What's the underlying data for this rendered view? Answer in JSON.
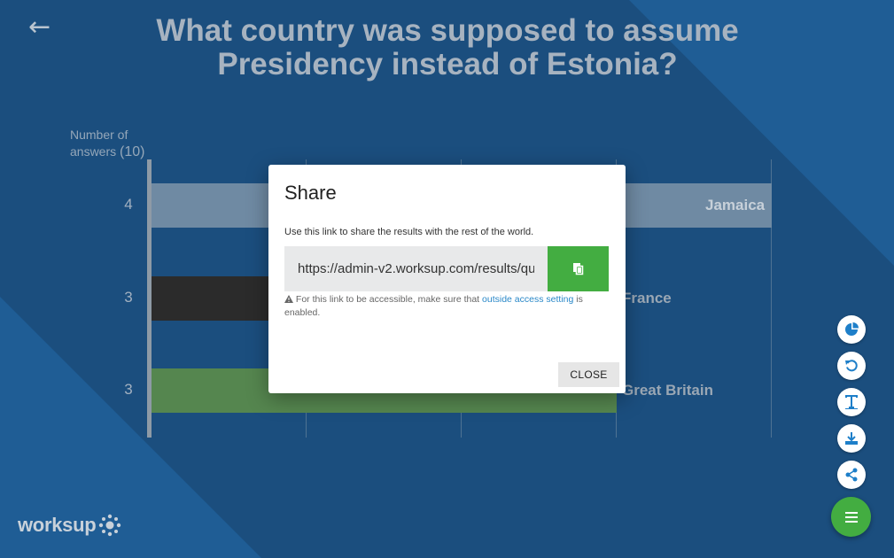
{
  "question": {
    "back_icon": "left-arrow-icon",
    "title": "What country was supposed to assume Presidency instead of Estonia?"
  },
  "chart_data": {
    "type": "bar",
    "orientation": "horizontal",
    "ylabel_prefix": "Number of answers",
    "total_answers": "(10)",
    "categories": [
      "Jamaica",
      "France",
      "Great Britain"
    ],
    "values": [
      4,
      3,
      3
    ],
    "tick_labels": [
      "4",
      "3",
      "3"
    ],
    "bar_colors": [
      "#6f8aa3",
      "#2b2b2b",
      "#55864f"
    ],
    "xlim": [
      0,
      4
    ],
    "grid": true
  },
  "modal": {
    "title": "Share",
    "description": "Use this link to share the results with the rest of the world.",
    "link_value": "https://admin-v2.worksup.com/results/qu",
    "copy_icon": "copy-icon",
    "note_prefix": "For this link to be accessible, make sure that",
    "note_link": "outside access setting",
    "note_suffix": "is enabled.",
    "warning_icon": "warning-icon",
    "close_label": "CLOSE"
  },
  "toolbar": {
    "items": [
      {
        "icon": "pie-chart-icon"
      },
      {
        "icon": "reset-icon"
      },
      {
        "icon": "text-icon"
      },
      {
        "icon": "download-icon"
      },
      {
        "icon": "share-icon"
      }
    ],
    "menu_icon": "menu-icon"
  },
  "brand": {
    "logo_text": "worksup",
    "accent": "#43ad41",
    "link_color": "#2a88c8"
  }
}
